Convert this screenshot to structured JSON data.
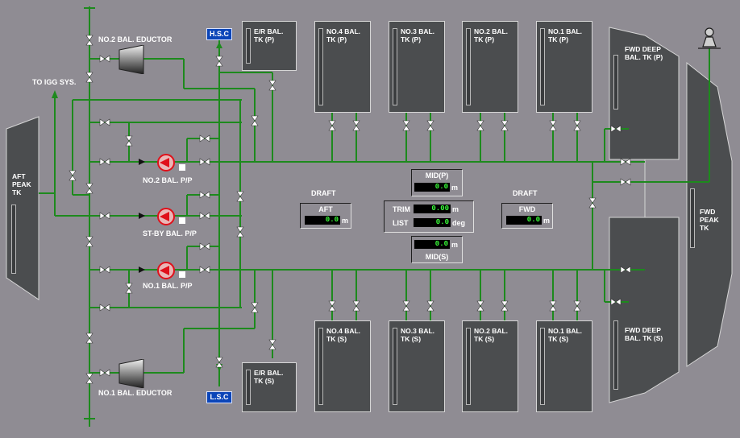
{
  "labels": {
    "to_igg": "TO IGG SYS.",
    "no2_eductor": "NO.2 BAL. EDUCTOR",
    "no1_eductor": "NO.1 BAL. EDUCTOR",
    "no2_pump": "NO.2 BAL. P/P",
    "stby_pump": "ST-BY BAL. P/P",
    "no1_pump": "NO.1 BAL. P/P",
    "hsc": "H.S.C",
    "lsc": "L.S.C",
    "draft_aft": "DRAFT",
    "draft_fwd": "DRAFT"
  },
  "tanks": {
    "aft_peak": "AFT\nPEAK\nTK",
    "fwd_peak": "FWD\nPEAK\nTK",
    "er_p": "E/R BAL.\nTK (P)",
    "er_s": "E/R BAL.\nTK (S)",
    "no4_p": "NO.4 BAL.\nTK (P)",
    "no3_p": "NO.3 BAL.\nTK (P)",
    "no2_p": "NO.2 BAL.\nTK (P)",
    "no1_p": "NO.1 BAL.\nTK (P)",
    "no4_s": "NO.4 BAL.\nTK (S)",
    "no3_s": "NO.3 BAL.\nTK (S)",
    "no2_s": "NO.2 BAL.\nTK (S)",
    "no1_s": "NO.1 BAL.\nTK (S)",
    "fwd_deep_p": "FWD DEEP\nBAL. TK (P)",
    "fwd_deep_s": "FWD DEEP\nBAL. TK (S)"
  },
  "readings": {
    "mid_p": {
      "caption": "MID(P)",
      "value": "0.0",
      "unit": "m"
    },
    "mid_s": {
      "caption": "MID(S)",
      "value": "0.0",
      "unit": "m"
    },
    "aft": {
      "caption": "AFT",
      "value": "0.0",
      "unit": "m"
    },
    "fwd": {
      "caption": "FWD",
      "value": "0.0",
      "unit": "m"
    },
    "trim": {
      "caption": "TRIM",
      "value": "0.00",
      "unit": "m"
    },
    "list": {
      "caption": "LIST",
      "value": "0.0",
      "unit": "deg"
    }
  },
  "colors": {
    "pipe": "#1d8a1d",
    "background": "#8f8c93",
    "tank": "#4b4d4f",
    "pump": "#e0101a",
    "tag": "#0b45b8"
  }
}
